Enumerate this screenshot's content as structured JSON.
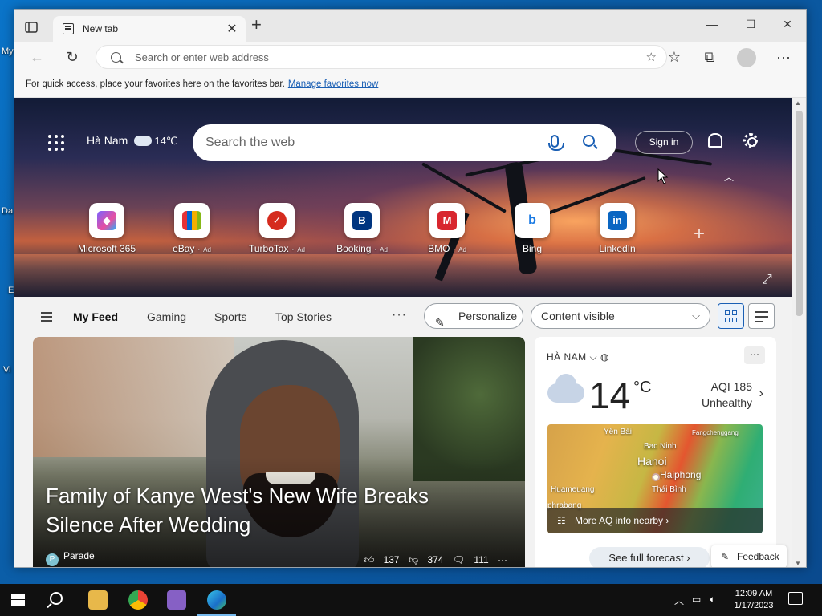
{
  "desktop": {
    "labels": [
      "My",
      "Da",
      "E",
      "Vi"
    ]
  },
  "browser": {
    "tab_title": "New tab",
    "tab_close": "✕",
    "new_tab": "+",
    "window_controls": {
      "minimize": "—",
      "maximize": "☐",
      "close": "✕"
    },
    "address_placeholder": "Search or enter web address",
    "favorites_bar_text": "For quick access, place your favorites here on the favorites bar.",
    "favorites_bar_link": "Manage favorites now"
  },
  "newtab": {
    "weather": {
      "location": "Hà Nam",
      "temp": "14℃"
    },
    "search_placeholder": "Search the web",
    "sign_in": "Sign in",
    "tiles": [
      {
        "label": "Microsoft 365",
        "ad": "",
        "icon": "microsoft365-icon",
        "color": "#7b61ff"
      },
      {
        "label": "eBay",
        "ad": "Ad",
        "icon": "ebay-icon",
        "color": "#e53238"
      },
      {
        "label": "TurboTax",
        "ad": "Ad",
        "icon": "turbotax-icon",
        "color": "#d52b1e"
      },
      {
        "label": "Booking",
        "ad": "Ad",
        "icon": "booking-icon",
        "color": "#003580"
      },
      {
        "label": "BMO",
        "ad": "Ad",
        "icon": "bmo-icon",
        "color": "#0079c1"
      },
      {
        "label": "Bing",
        "ad": "",
        "icon": "bing-icon",
        "color": "#ffffff"
      },
      {
        "label": "LinkedIn",
        "ad": "",
        "icon": "linkedin-icon",
        "color": "#0a66c2"
      }
    ]
  },
  "feed": {
    "tabs": [
      "My Feed",
      "Gaming",
      "Sports",
      "Top Stories"
    ],
    "more": "···",
    "personalize": "Personalize",
    "content_visibility": "Content visible"
  },
  "article": {
    "headline": "Family of Kanye West's New Wife Breaks Silence After Wedding",
    "source": "Parade",
    "likes": "137",
    "dislikes": "374",
    "comments": "111",
    "more": "···"
  },
  "weather_card": {
    "location": "HÀ NAM",
    "temp": "14",
    "unit": "°C",
    "aqi": "AQI 185",
    "aqi_status": "Unhealthy",
    "map_labels": {
      "yen_bai": "Yên Bái",
      "bac_ninh": "Bac Ninh",
      "fangchenggang": "Fangchenggang",
      "hanoi": "Hanoi",
      "haiphong": "Haiphong",
      "huameuang": "Huameuang",
      "thai_binh": "Thái Bình",
      "phrabang": "phrabang"
    },
    "more_aq": "More AQ info nearby",
    "forecast": "See full forecast"
  },
  "feedback": "Feedback",
  "taskbar": {
    "time": "12:09 AM",
    "date": "1/17/2023"
  }
}
